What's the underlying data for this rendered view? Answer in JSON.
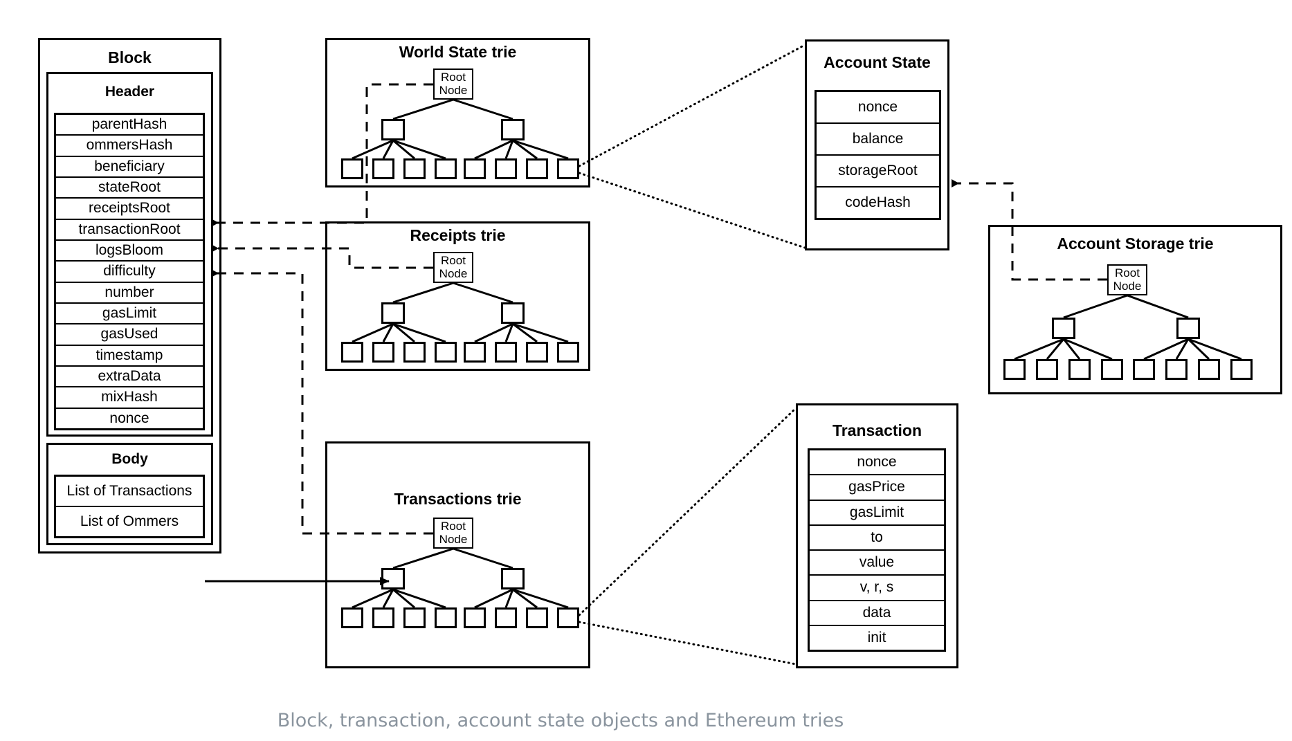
{
  "caption": "Block, transaction, account state objects and Ethereum tries",
  "block": {
    "title": "Block",
    "header": {
      "title": "Header",
      "fields": [
        "parentHash",
        "ommersHash",
        "beneficiary",
        "stateRoot",
        "receiptsRoot",
        "transactionRoot",
        "logsBloom",
        "difficulty",
        "number",
        "gasLimit",
        "gasUsed",
        "timestamp",
        "extraData",
        "mixHash",
        "nonce"
      ]
    },
    "body": {
      "title": "Body",
      "fields": [
        "List of Transactions",
        "List of Ommers"
      ]
    }
  },
  "tries": {
    "world_state": {
      "title": "World State trie",
      "root_label_line1": "Root",
      "root_label_line2": "Node"
    },
    "receipts": {
      "title": "Receipts trie",
      "root_label_line1": "Root",
      "root_label_line2": "Node"
    },
    "transactions": {
      "title": "Transactions trie",
      "root_label_line1": "Root",
      "root_label_line2": "Node"
    },
    "account_storage": {
      "title": "Account Storage trie",
      "root_label_line1": "Root",
      "root_label_line2": "Node"
    }
  },
  "account_state": {
    "title": "Account State",
    "fields": [
      "nonce",
      "balance",
      "storageRoot",
      "codeHash"
    ]
  },
  "transaction": {
    "title": "Transaction",
    "fields": [
      "nonce",
      "gasPrice",
      "gasLimit",
      "to",
      "value",
      "v, r, s",
      "data",
      "init"
    ]
  },
  "colors": {
    "stroke": "#000000",
    "background": "#ffffff",
    "caption": "#8a949e"
  }
}
